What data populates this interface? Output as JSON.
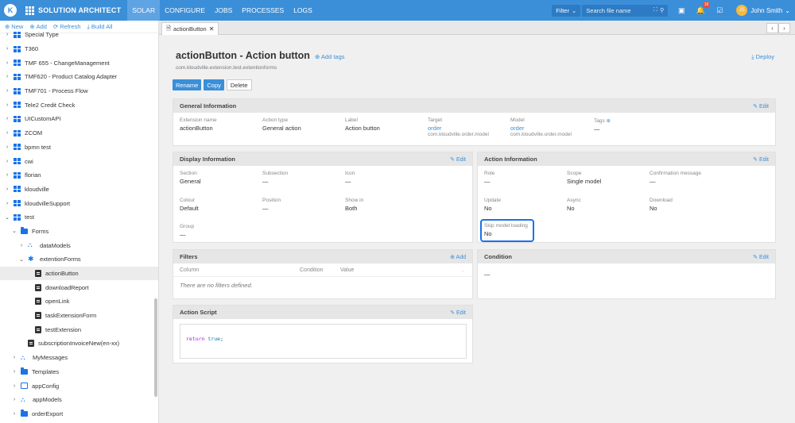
{
  "topbar": {
    "logo": "K",
    "app_name": "SOLUTION ARCHITECT",
    "nav": [
      "SOLAR",
      "CONFIGURE",
      "JOBS",
      "PROCESSES",
      "LOGS"
    ],
    "active_nav": "SOLAR",
    "filter_label": "Filter",
    "search_placeholder": "Search file name",
    "notification_count": "10",
    "user_initials": "JS",
    "user_name": "John Smith"
  },
  "sidebar": {
    "toolbar": {
      "new": "New",
      "add": "Add",
      "refresh": "Refresh",
      "build_all": "Build All"
    },
    "items": [
      {
        "label": "Special Type",
        "icon": "grid-icon",
        "chevron": "›"
      },
      {
        "label": "T360",
        "icon": "grid-icon",
        "chevron": "›"
      },
      {
        "label": "TMF 655 - ChangeManagement",
        "icon": "grid-icon",
        "chevron": "›"
      },
      {
        "label": "TMF620 - Product Catalog Adapter",
        "icon": "grid-icon",
        "chevron": "›"
      },
      {
        "label": "TMF701 - Process Flow",
        "icon": "grid-icon",
        "chevron": "›"
      },
      {
        "label": "Tele2 Credit Check",
        "icon": "grid-icon",
        "chevron": "›"
      },
      {
        "label": "UICustomAPI",
        "icon": "grid-icon",
        "chevron": "›"
      },
      {
        "label": "ZCOM",
        "icon": "grid-icon",
        "chevron": "›"
      },
      {
        "label": "bpmn test",
        "icon": "grid-icon",
        "chevron": "›"
      },
      {
        "label": "cwi",
        "icon": "grid-icon",
        "chevron": "›"
      },
      {
        "label": "florian",
        "icon": "grid-icon",
        "chevron": "›"
      },
      {
        "label": "kloudville",
        "icon": "grid-icon",
        "chevron": "›"
      },
      {
        "label": "kloudvilleSupport",
        "icon": "grid-icon",
        "chevron": "›"
      },
      {
        "label": "test",
        "icon": "grid-icon",
        "chevron": "⌄"
      },
      {
        "label": "Forms",
        "icon": "folder-icon",
        "chevron": "⌄"
      },
      {
        "label": "dataModels",
        "icon": "network-icon",
        "chevron": "›"
      },
      {
        "label": "extentionForms",
        "icon": "puzzle-icon",
        "chevron": "⌄"
      },
      {
        "label": "actionButton",
        "icon": "form-doc-icon",
        "chevron": ""
      },
      {
        "label": "downloadReport",
        "icon": "form-doc-icon",
        "chevron": ""
      },
      {
        "label": "openLink",
        "icon": "form-doc-icon",
        "chevron": ""
      },
      {
        "label": "taskExtensionForm",
        "icon": "form-doc-icon",
        "chevron": ""
      },
      {
        "label": "testExtension",
        "icon": "form-doc-icon",
        "chevron": ""
      },
      {
        "label": "subscriptionInvoiceNew(en-xx)",
        "icon": "form-doc-icon",
        "chevron": ""
      },
      {
        "label": "MyMessages",
        "icon": "network-icon",
        "chevron": "›"
      },
      {
        "label": "Templates",
        "icon": "folder-icon",
        "chevron": "›"
      },
      {
        "label": "appConfig",
        "icon": "config-icon",
        "chevron": "›"
      },
      {
        "label": "appModels",
        "icon": "network-icon",
        "chevron": "›"
      },
      {
        "label": "orderExport",
        "icon": "folder-icon",
        "chevron": "›"
      }
    ]
  },
  "tab": {
    "label": "actionButton"
  },
  "header": {
    "title": "actionButton - Action button",
    "add_tags": "Add tags",
    "subpath": "com.kloudville.extension.test.extentionforms",
    "deploy": "Deploy",
    "buttons": {
      "rename": "Rename",
      "copy": "Copy",
      "delete": "Delete"
    }
  },
  "general": {
    "title": "General Information",
    "edit": "Edit",
    "fields": {
      "extension_name": {
        "label": "Extension name",
        "value": "actionButton"
      },
      "action_type": {
        "label": "Action type",
        "value": "General action"
      },
      "label": {
        "label": "Label",
        "value": "Action button"
      },
      "target": {
        "label": "Target",
        "value": "order",
        "sub": "com.kloudville.order.model"
      },
      "model": {
        "label": "Model",
        "value": "order",
        "sub": "com.kloudville.order.model"
      },
      "tags": {
        "label": "Tags",
        "value": "—"
      }
    }
  },
  "display": {
    "title": "Display Information",
    "edit": "Edit",
    "fields": {
      "section": {
        "label": "Section",
        "value": "General"
      },
      "subsection": {
        "label": "Subsection",
        "value": "—"
      },
      "icon": {
        "label": "Icon",
        "value": "—"
      },
      "colour": {
        "label": "Colour",
        "value": "Default"
      },
      "position": {
        "label": "Position",
        "value": "—"
      },
      "show_in": {
        "label": "Show in",
        "value": "Both"
      },
      "group": {
        "label": "Group",
        "value": "—"
      }
    }
  },
  "action_info": {
    "title": "Action Information",
    "edit": "Edit",
    "fields": {
      "role": {
        "label": "Role",
        "value": "—"
      },
      "scope": {
        "label": "Scope",
        "value": "Single model"
      },
      "confirmation": {
        "label": "Confirmation message",
        "value": "—"
      },
      "update": {
        "label": "Update",
        "value": "No"
      },
      "async": {
        "label": "Async",
        "value": "No"
      },
      "download": {
        "label": "Download",
        "value": "No"
      },
      "skip_model_loading": {
        "label": "Skip model loading",
        "value": "No"
      }
    }
  },
  "filters": {
    "title": "Filters",
    "add": "Add",
    "columns": [
      "Column",
      "Condition",
      "Value"
    ],
    "empty": "There are no filters defined."
  },
  "condition": {
    "title": "Condition",
    "edit": "Edit",
    "value": "—"
  },
  "script": {
    "title": "Action Script",
    "edit": "Edit",
    "keyword": "return",
    "literal": "true",
    "end": ";"
  }
}
